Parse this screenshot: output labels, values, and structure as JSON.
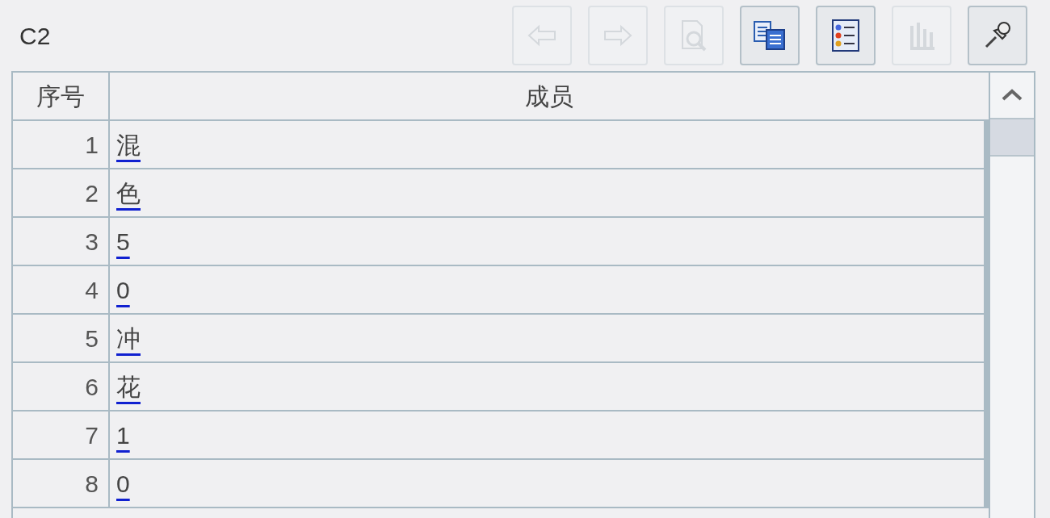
{
  "title": "C2",
  "toolbar": [
    {
      "kind": "back",
      "disabled": true
    },
    {
      "kind": "forward",
      "disabled": true
    },
    {
      "kind": "preview",
      "disabled": true
    },
    {
      "kind": "copy",
      "disabled": false
    },
    {
      "kind": "list",
      "disabled": false
    },
    {
      "kind": "chart",
      "disabled": true
    },
    {
      "kind": "pin",
      "disabled": false
    }
  ],
  "table": {
    "columns": [
      "序号",
      "成员"
    ],
    "rows": [
      {
        "index": "1",
        "member": "混"
      },
      {
        "index": "2",
        "member": "色"
      },
      {
        "index": "3",
        "member": "5"
      },
      {
        "index": "4",
        "member": "0"
      },
      {
        "index": "5",
        "member": "冲"
      },
      {
        "index": "6",
        "member": "花"
      },
      {
        "index": "7",
        "member": "1"
      },
      {
        "index": "8",
        "member": "0"
      }
    ]
  }
}
